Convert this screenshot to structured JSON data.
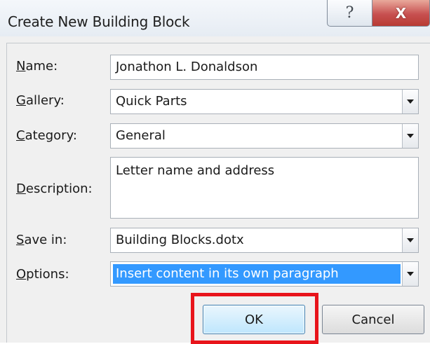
{
  "window": {
    "title": "Create New Building Block",
    "help_glyph": "?",
    "close_glyph": "X"
  },
  "form": {
    "name": {
      "label_accel": "N",
      "label_rest": "ame:",
      "value": "Jonathon L. Donaldson"
    },
    "gallery": {
      "label_accel": "G",
      "label_rest": "allery:",
      "value": "Quick Parts"
    },
    "category": {
      "label_accel": "C",
      "label_rest": "ategory:",
      "value": "General"
    },
    "description": {
      "label_pre": "",
      "label_accel": "D",
      "label_rest": "escription:",
      "value": "Letter name and address"
    },
    "save_in": {
      "label_accel": "S",
      "label_rest": "ave in:",
      "value": "Building Blocks.dotx"
    },
    "options": {
      "label_accel": "O",
      "label_rest": "ptions:",
      "value": "Insert content in its own paragraph"
    }
  },
  "buttons": {
    "ok": "OK",
    "cancel": "Cancel"
  },
  "colors": {
    "highlight": "#e8141b",
    "selection": "#3399ff"
  }
}
